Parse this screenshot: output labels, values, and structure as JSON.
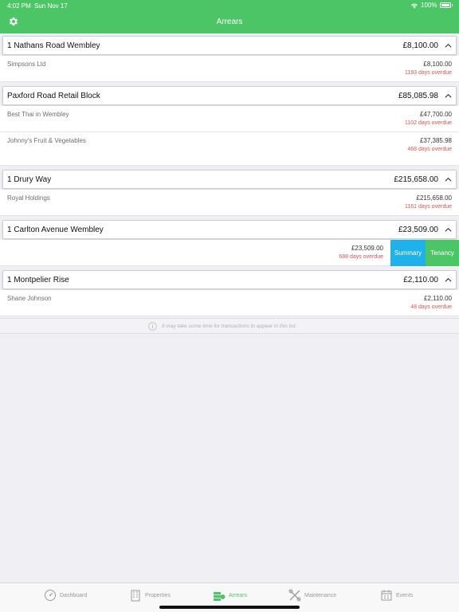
{
  "status": {
    "time": "4:02 PM",
    "date": "Sun Nov 17",
    "battery": "100%"
  },
  "nav": {
    "title": "Arrears",
    "settings_icon": "gear-icon"
  },
  "properties": [
    {
      "name": "1 Nathans Road Wembley",
      "total": "£8,100.00",
      "tenants": [
        {
          "name": "Simpsons Ltd",
          "amount": "£8,100.00",
          "overdue": "1193 days overdue"
        }
      ]
    },
    {
      "name": "Paxford Road Retail Block",
      "total": "£85,085.98",
      "tenants": [
        {
          "name": "Best Thai in Wembley",
          "amount": "£47,700.00",
          "overdue": "1102 days overdue"
        },
        {
          "name": "Johnny's Fruit & Vegetables",
          "amount": "£37,385.98",
          "overdue": "468 days overdue"
        }
      ]
    },
    {
      "name": "1 Drury Way",
      "total": "£215,658.00",
      "tenants": [
        {
          "name": "Royal Holdings",
          "amount": "£215,658.00",
          "overdue": "1161 days overdue"
        }
      ]
    },
    {
      "name": "1 Carlton Avenue Wembley",
      "total": "£23,509.00",
      "tenants": [
        {
          "name": "",
          "amount": "£23,509.00",
          "overdue": "688 days overdue",
          "actions": [
            "Summary",
            "Tenancy"
          ]
        }
      ]
    },
    {
      "name": "1 Montpelier Rise",
      "total": "£2,110.00",
      "tenants": [
        {
          "name": "Shane Johnson",
          "amount": "£2,110.00",
          "overdue": "48 days overdue"
        }
      ]
    }
  ],
  "info": {
    "text": "It may take some time for transactions to appear in this list."
  },
  "tabs": [
    {
      "label": "Dashboard",
      "icon": "speedometer-icon",
      "active": false
    },
    {
      "label": "Properties",
      "icon": "building-icon",
      "active": false
    },
    {
      "label": "Arrears",
      "icon": "money-stack-icon",
      "active": true
    },
    {
      "label": "Maintenance",
      "icon": "tools-icon",
      "active": false
    },
    {
      "label": "Events",
      "icon": "calendar-icon",
      "active": false
    }
  ],
  "colors": {
    "accent": "#4cc567",
    "overdue": "#d9534f",
    "summary": "#1eb1ea"
  }
}
